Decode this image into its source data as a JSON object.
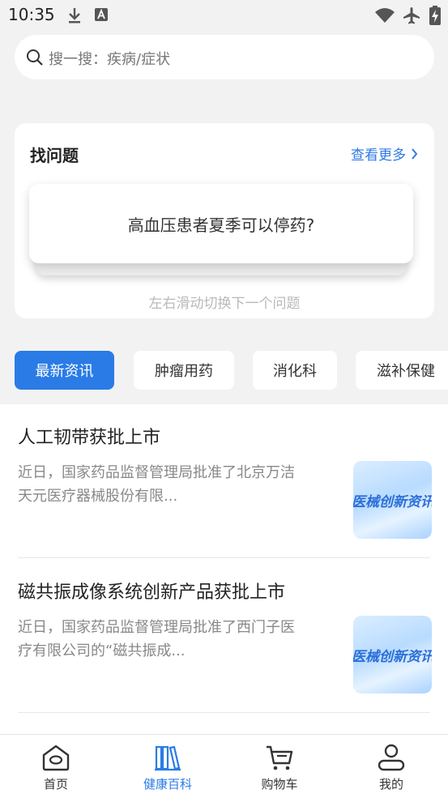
{
  "status_bar": {
    "time": "10:35"
  },
  "search": {
    "placeholder": "搜一搜：疾病/症状"
  },
  "question_card": {
    "title": "找问题",
    "more_label": "查看更多",
    "question": "高血压患者夏季可以停药?",
    "swipe_hint": "左右滑动切换下一个问题"
  },
  "tabs": [
    {
      "label": "最新资讯",
      "active": true
    },
    {
      "label": "肿瘤用药",
      "active": false
    },
    {
      "label": "消化科",
      "active": false
    },
    {
      "label": "滋补保健",
      "active": false
    }
  ],
  "articles": [
    {
      "title": "人工韧带获批上市",
      "summary": "近日，国家药品监督管理局批准了北京万洁天元医疗器械股份有限...",
      "thumb_text": "医械创新资讯"
    },
    {
      "title": "磁共振成像系统创新产品获批上市",
      "summary": "近日，国家药品监督管理局批准了西门子医疗有限公司的“磁共振成...",
      "thumb_text": "医械创新资讯"
    }
  ],
  "bottom_nav": [
    {
      "label": "首页",
      "icon": "home-icon",
      "active": false
    },
    {
      "label": "健康百科",
      "icon": "books-icon",
      "active": true
    },
    {
      "label": "购物车",
      "icon": "cart-icon",
      "active": false
    },
    {
      "label": "我的",
      "icon": "person-icon",
      "active": false
    }
  ],
  "colors": {
    "accent": "#2a7be6",
    "link": "#2f7ae5"
  }
}
